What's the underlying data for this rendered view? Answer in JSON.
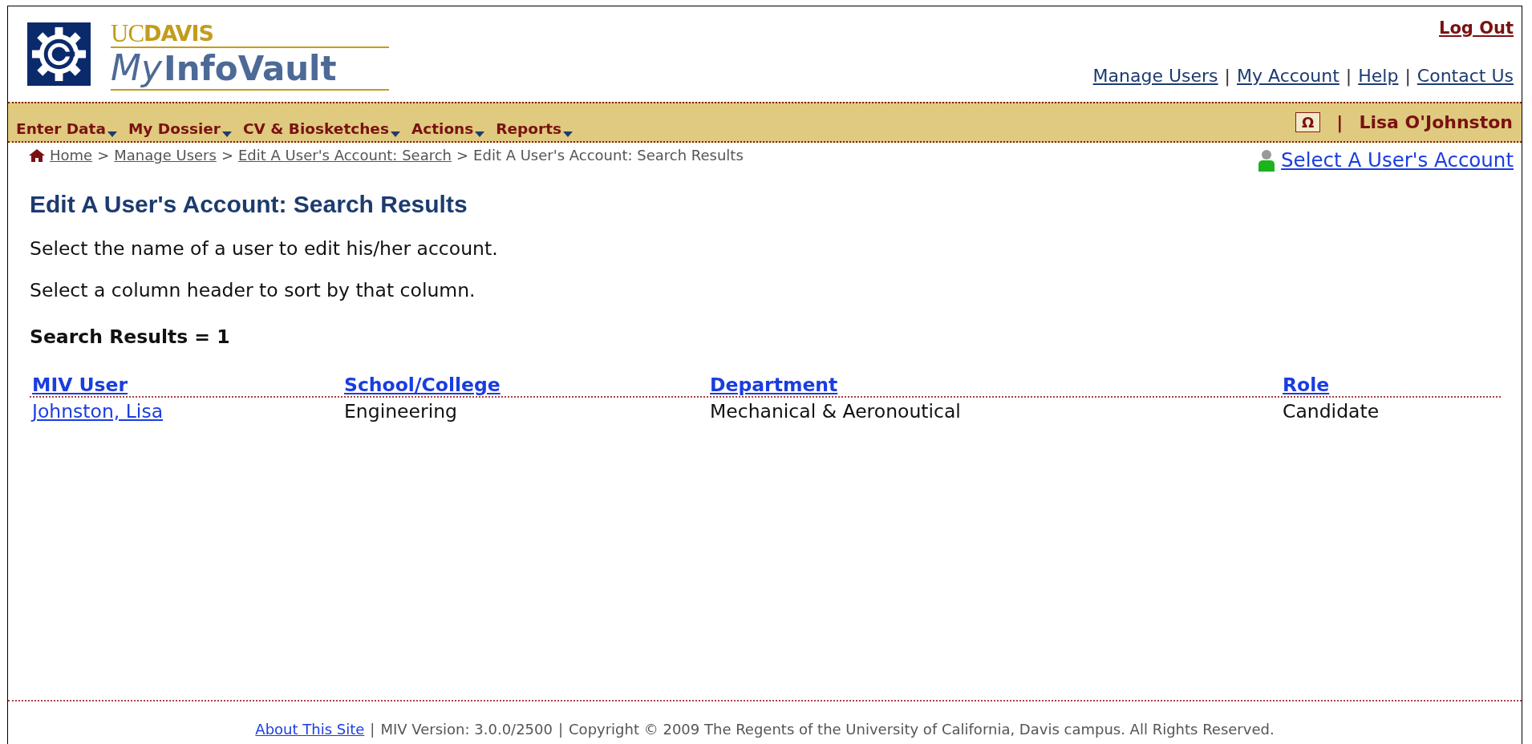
{
  "header": {
    "logo": {
      "org_prefix": "UC",
      "org": "DAVIS",
      "app_prefix": "My",
      "app": "InfoVault"
    },
    "logout": "Log Out",
    "links": [
      "Manage Users",
      "My Account",
      "Help",
      "Contact Us"
    ],
    "link_separator": "|"
  },
  "menu": {
    "items": [
      "Enter Data",
      "My Dossier",
      "CV & Biosketches",
      "Actions",
      "Reports"
    ],
    "special_characters_button": "Ω",
    "separator": "|",
    "user_name": "Lisa O'Johnston"
  },
  "breadcrumb": {
    "links": [
      "Home",
      "Manage Users",
      "Edit A User's Account: Search"
    ],
    "separator": ">",
    "current": "Edit A User's Account: Search Results"
  },
  "select_account_link": "Select A User's Account",
  "page_title": "Edit A User's Account: Search Results",
  "instructions": [
    "Select the name of a user to edit his/her account.",
    "Select a column header to sort by that column."
  ],
  "result_count": "Search Results = 1",
  "table": {
    "columns": [
      "MIV User",
      "School/College",
      "Department",
      "Role"
    ],
    "rows": [
      {
        "cells": [
          "Johnston, Lisa",
          "Engineering",
          "Mechanical & Aeronoutical",
          "Candidate"
        ]
      }
    ]
  },
  "footer": {
    "link": "About This Site",
    "texts": [
      "MIV Version: 3.0.0/2500",
      "Copyright © 2009 The Regents of the University of California, Davis campus. All Rights Reserved."
    ],
    "separator": "|"
  }
}
